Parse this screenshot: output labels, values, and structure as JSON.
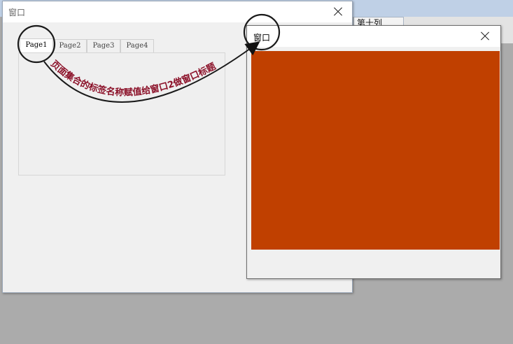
{
  "background_app": {
    "column_header": "第十列"
  },
  "window1": {
    "title": "窗口",
    "tabs": [
      "Page1",
      "Page2",
      "Page3",
      "Page4"
    ],
    "active_tab": "Page1"
  },
  "window2": {
    "title": "窗口",
    "content_color": "#c04000"
  },
  "annotation": {
    "text": "页面集合的标签名称赋值给窗口2做窗口标题",
    "color": "#8b1028"
  },
  "icons": {
    "close": "close-icon",
    "arrow": "arrow-icon"
  }
}
